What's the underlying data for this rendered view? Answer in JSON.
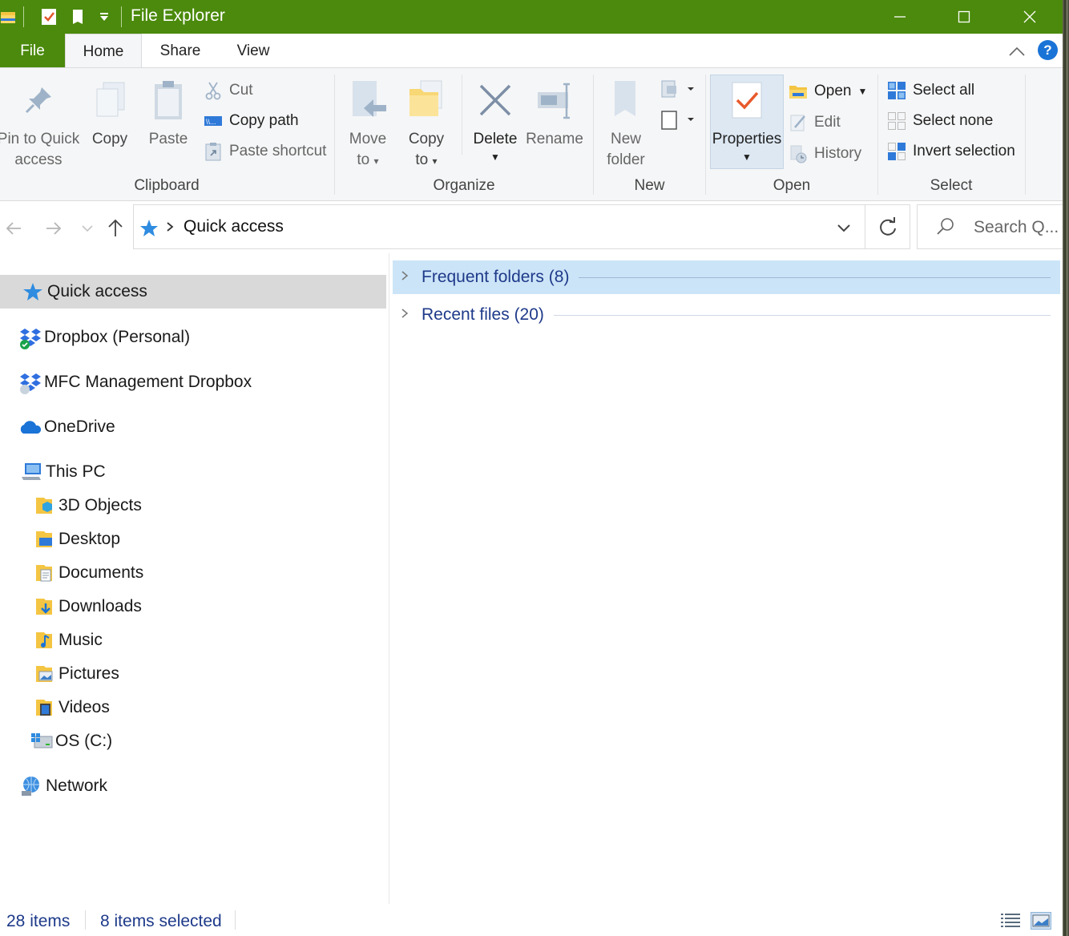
{
  "window": {
    "title": "File Explorer",
    "accent": "#4b8a0c"
  },
  "tabs": {
    "file": "File",
    "home": "Home",
    "share": "Share",
    "view": "View",
    "help": "?"
  },
  "ribbon": {
    "clipboard": {
      "label": "Clipboard",
      "pin_line1": "Pin to Quick",
      "pin_line2": "access",
      "copy": "Copy",
      "paste": "Paste",
      "cut": "Cut",
      "copy_path": "Copy path",
      "paste_shortcut": "Paste shortcut"
    },
    "organize": {
      "label": "Organize",
      "move_line1": "Move",
      "move_line2": "to",
      "copy_line1": "Copy",
      "copy_line2": "to",
      "delete": "Delete",
      "rename": "Rename"
    },
    "new": {
      "label": "New",
      "folder_line1": "New",
      "folder_line2": "folder"
    },
    "open": {
      "label": "Open",
      "properties": "Properties",
      "open": "Open",
      "edit": "Edit",
      "history": "History"
    },
    "select": {
      "label": "Select",
      "select_all": "Select all",
      "select_none": "Select none",
      "invert": "Invert selection"
    }
  },
  "address": {
    "location": "Quick access",
    "search_placeholder": "Search Q..."
  },
  "nav": {
    "quick_access": "Quick access",
    "dropbox_personal": "Dropbox (Personal)",
    "mfc_dropbox": "MFC Management Dropbox",
    "onedrive": "OneDrive",
    "this_pc": "This PC",
    "objects3d": "3D Objects",
    "desktop": "Desktop",
    "documents": "Documents",
    "downloads": "Downloads",
    "music": "Music",
    "pictures": "Pictures",
    "videos": "Videos",
    "os_c": "OS (C:)",
    "network": "Network"
  },
  "content": {
    "groups": [
      {
        "label": "Frequent folders",
        "count": "(8)"
      },
      {
        "label": "Recent files",
        "count": "(20)"
      }
    ]
  },
  "status": {
    "items": "28 items",
    "selected": "8 items selected"
  }
}
